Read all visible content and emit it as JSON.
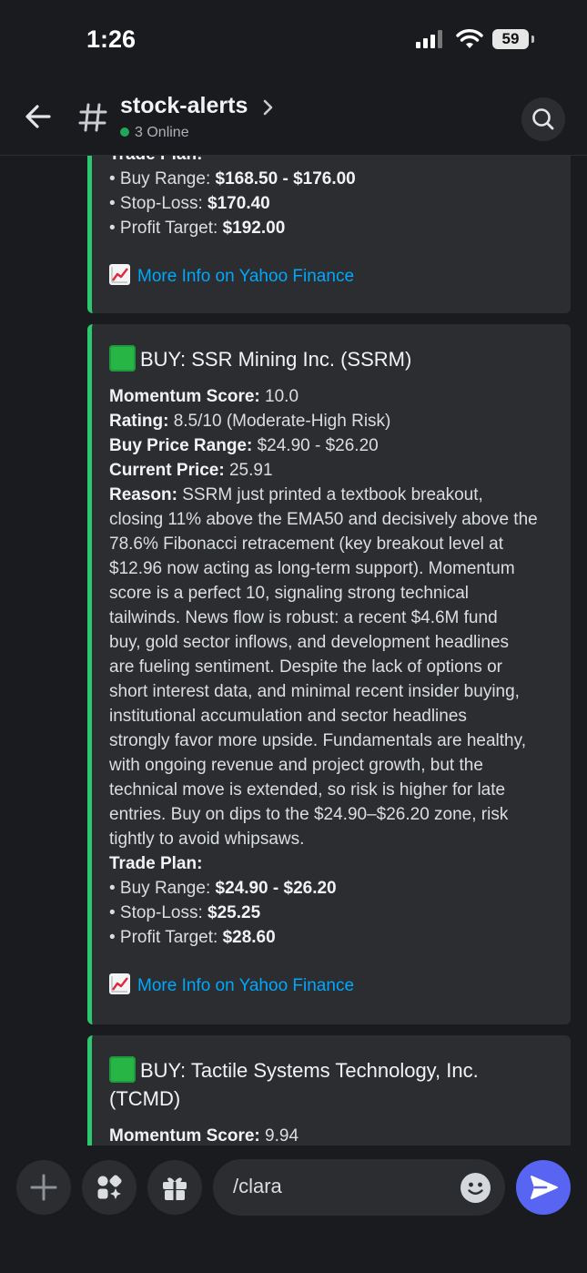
{
  "status_bar": {
    "time": "1:26",
    "battery": "59"
  },
  "header": {
    "channel_name": "stock-alerts",
    "online_text": "3 Online"
  },
  "embed_top": {
    "trade_plan_label": "Trade Plan:",
    "bullets": [
      {
        "label": "• Buy Range: ",
        "value": "$168.50 - $176.00"
      },
      {
        "label": "• Stop-Loss: ",
        "value": "$170.40"
      },
      {
        "label": "• Profit Target: ",
        "value": "$192.00"
      }
    ],
    "link_text": "More Info on Yahoo Finance"
  },
  "embed_ssrm": {
    "title": "BUY: SSR Mining Inc. (SSRM)",
    "fields": [
      {
        "label": "Momentum Score:",
        "value": " 10.0"
      },
      {
        "label": "Rating:",
        "value": " 8.5/10 (Moderate-High Risk)"
      },
      {
        "label": "Buy Price Range:",
        "value": " $24.90 - $26.20"
      },
      {
        "label": "Current Price:",
        "value": " 25.91"
      }
    ],
    "reason_label": "Reason:",
    "reason_lines": [
      " SSRM just printed a textbook breakout,",
      "closing 11% above the EMA50 and decisively above the",
      "78.6% Fibonacci retracement (key breakout level at",
      "$12.96 now acting as long-term support). Momentum",
      "score is a perfect 10, signaling strong technical",
      "tailwinds. News flow is robust: a recent $4.6M fund",
      "buy, gold sector inflows, and development headlines",
      "are fueling sentiment. Despite the lack of options or",
      "short interest data, and minimal recent insider buying,",
      "institutional accumulation and sector headlines",
      "strongly favor more upside. Fundamentals are healthy,",
      "with ongoing revenue and project growth, but the",
      "technical move is extended, so risk is higher for late",
      "entries. Buy on dips to the $24.90–$26.20 zone, risk",
      "tightly to avoid whipsaws."
    ],
    "trade_plan_label": "Trade Plan:",
    "bullets": [
      {
        "label": "• Buy Range: ",
        "value": "$24.90 - $26.20"
      },
      {
        "label": "• Stop-Loss: ",
        "value": "$25.25"
      },
      {
        "label": "• Profit Target: ",
        "value": "$28.60"
      }
    ],
    "link_text": "More Info on Yahoo Finance"
  },
  "embed_tcmd": {
    "title_line1": "BUY: Tactile Systems Technology, Inc.",
    "title_line2": "(TCMD)",
    "momentum_label": "Momentum Score:",
    "momentum_value": " 9.94"
  },
  "composer": {
    "input_value": "/clara"
  },
  "colors": {
    "embed_border": "#2dc770",
    "link": "#00a8fc",
    "send": "#5865f2",
    "online": "#23a55a"
  },
  "icons": [
    "back-arrow-icon",
    "hash-icon",
    "chevron-right-icon",
    "search-icon",
    "plus-icon",
    "apps-icon",
    "gift-icon",
    "emoji-icon",
    "send-icon",
    "chart-increasing-icon",
    "green-square-icon"
  ]
}
